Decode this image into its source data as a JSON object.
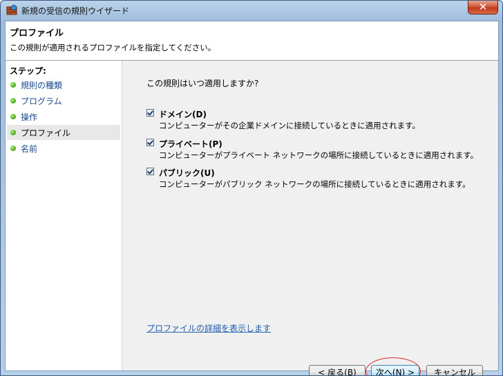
{
  "window": {
    "title": "新規の受信の規則ウイザード",
    "close_label": "✕"
  },
  "header": {
    "title": "プロファイル",
    "description": "この規則が適用されるプロファイルを指定してください。"
  },
  "steps": {
    "label": "ステップ:",
    "items": [
      {
        "label": "規則の種類"
      },
      {
        "label": "プログラム"
      },
      {
        "label": "操作"
      },
      {
        "label": "プロファイル"
      },
      {
        "label": "名前"
      }
    ]
  },
  "main": {
    "question": "この規則はいつ適用しますか?",
    "options": [
      {
        "title": "ドメイン(D)",
        "description": "コンピューターがその企業ドメインに接続しているときに適用されます。",
        "checked": true
      },
      {
        "title": "プライベート(P)",
        "description": "コンピューターがプライベート ネットワークの場所に接続しているときに適用されます。",
        "checked": true
      },
      {
        "title": "パブリック(U)",
        "description": "コンピューターがパブリック ネットワークの場所に接続しているときに適用されます。",
        "checked": true
      }
    ],
    "details_link": "プロファイルの詳細を表示します"
  },
  "buttons": {
    "back": "< 戻る(B)",
    "next": "次へ(N) >",
    "cancel": "キャンセル"
  }
}
